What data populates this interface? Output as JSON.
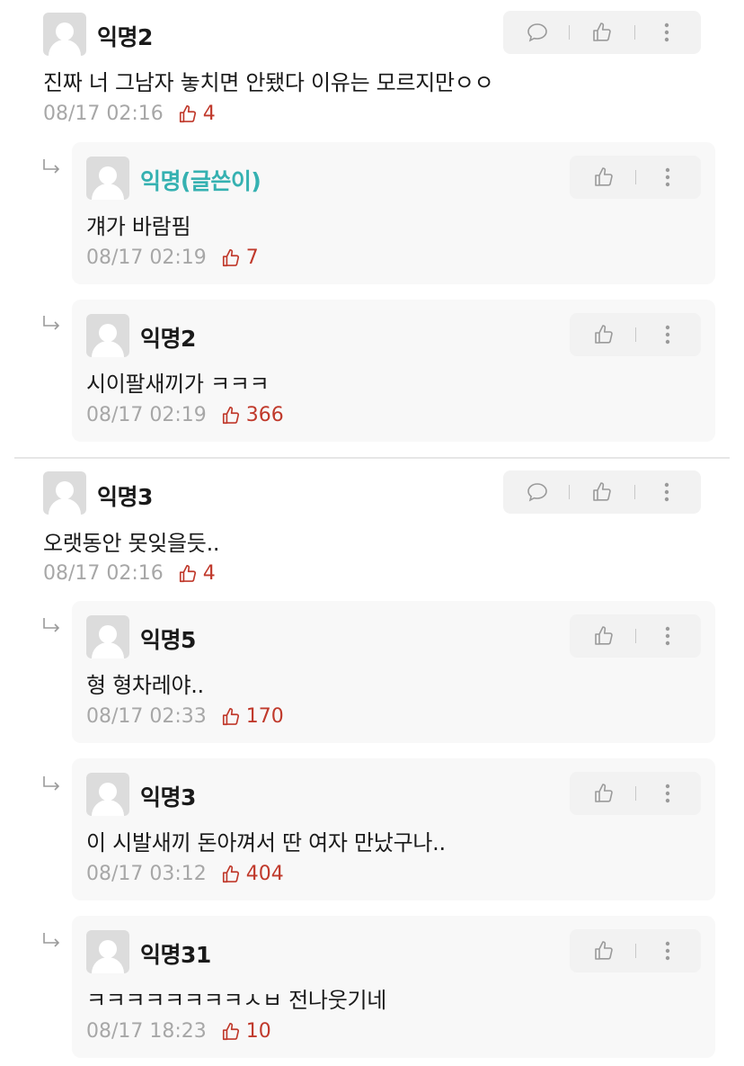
{
  "comments": [
    {
      "author": "익명2",
      "text": "진짜 너 그남자 놓치면 안됐다 이유는 모르지만ㅇㅇ",
      "time": "08/17 02:16",
      "likes": "4",
      "replies": [
        {
          "author": "익명(글쓴이)",
          "is_op": true,
          "text": "걔가 바람핌",
          "time": "08/17 02:19",
          "likes": "7"
        },
        {
          "author": "익명2",
          "is_op": false,
          "text": "시이팔새끼가 ㅋㅋㅋ",
          "time": "08/17 02:19",
          "likes": "366"
        }
      ]
    },
    {
      "author": "익명3",
      "text": "오랫동안 못잊을듯..",
      "time": "08/17 02:16",
      "likes": "4",
      "replies": [
        {
          "author": "익명5",
          "is_op": false,
          "text": "형 형차레야..",
          "time": "08/17 02:33",
          "likes": "170"
        },
        {
          "author": "익명3",
          "is_op": false,
          "text": "이 시발새끼 돈아껴서 딴 여자 만났구나..",
          "time": "08/17 03:12",
          "likes": "404"
        },
        {
          "author": "익명31",
          "is_op": false,
          "text": "ㅋㅋㅋㅋㅋㅋㅋㅋㅅㅂ 전나웃기네",
          "time": "08/17 18:23",
          "likes": "10"
        }
      ]
    }
  ],
  "icons": {
    "comment": "speech-bubble-icon",
    "like": "thumbs-up-icon",
    "more": "vertical-dots-icon",
    "reply_arrow": "reply-arrow-icon"
  },
  "colors": {
    "like_count": "#c0392b",
    "op_name": "#35b1b1",
    "meta": "#a7a7a7",
    "reply_bg": "#f8f8f8",
    "action_bg": "#f2f2f2"
  }
}
